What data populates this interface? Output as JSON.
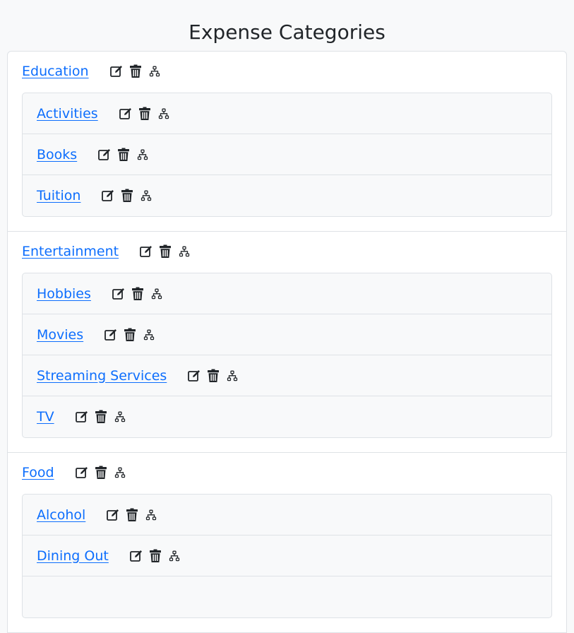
{
  "page": {
    "title": "Expense Categories"
  },
  "groups": [
    {
      "name": "Education",
      "children": [
        "Activities",
        "Books",
        "Tuition"
      ]
    },
    {
      "name": "Entertainment",
      "children": [
        "Hobbies",
        "Movies",
        "Streaming Services",
        "TV"
      ]
    },
    {
      "name": "Food",
      "children": [
        "Alcohol",
        "Dining Out",
        ""
      ]
    }
  ],
  "icons": {
    "edit": "edit-icon",
    "delete": "trash-icon",
    "subcategories": "hierarchy-icon"
  },
  "colors": {
    "link": "#0d6efd",
    "background": "#f8f9fa",
    "border": "#dee2e6"
  }
}
